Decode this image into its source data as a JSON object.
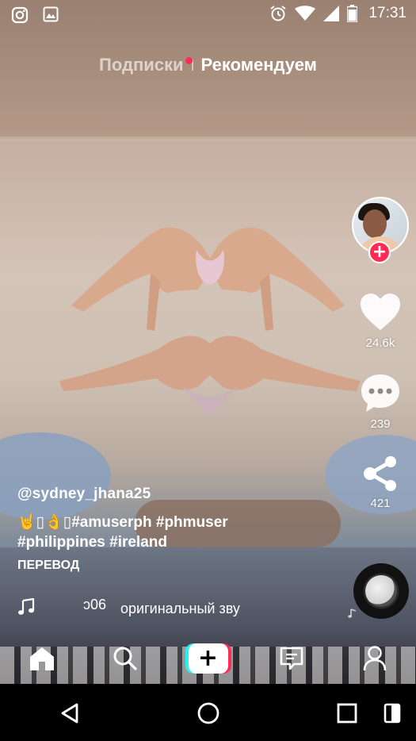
{
  "status_bar": {
    "time": "17:31",
    "left_icons": [
      "instagram-icon",
      "image-icon"
    ],
    "right_icons": [
      "alarm-icon",
      "wifi-icon",
      "signal-icon",
      "battery-icon"
    ]
  },
  "top_tabs": {
    "following": "Подписки",
    "for_you": "Рекомендуем"
  },
  "actions": {
    "likes": "24.6k",
    "comments": "239",
    "shares": "421"
  },
  "caption": {
    "username": "@sydney_jhana25",
    "emoji": "🤘▯👌▯",
    "tags_line1": "#amuserph #phmuser",
    "tags_line2": "#philippines #ireland",
    "translate": "ПЕРЕВОД"
  },
  "music": {
    "left_fragment": "ɔ06",
    "title": "оригинальный зву"
  },
  "colors": {
    "accent": "#fe2c55",
    "cyan": "#25f4ee"
  },
  "bottom_nav": [
    "home-icon",
    "search-icon",
    "create-button",
    "inbox-icon",
    "profile-icon"
  ],
  "system_nav": [
    "back-icon",
    "home-circle-icon",
    "recents-icon"
  ]
}
